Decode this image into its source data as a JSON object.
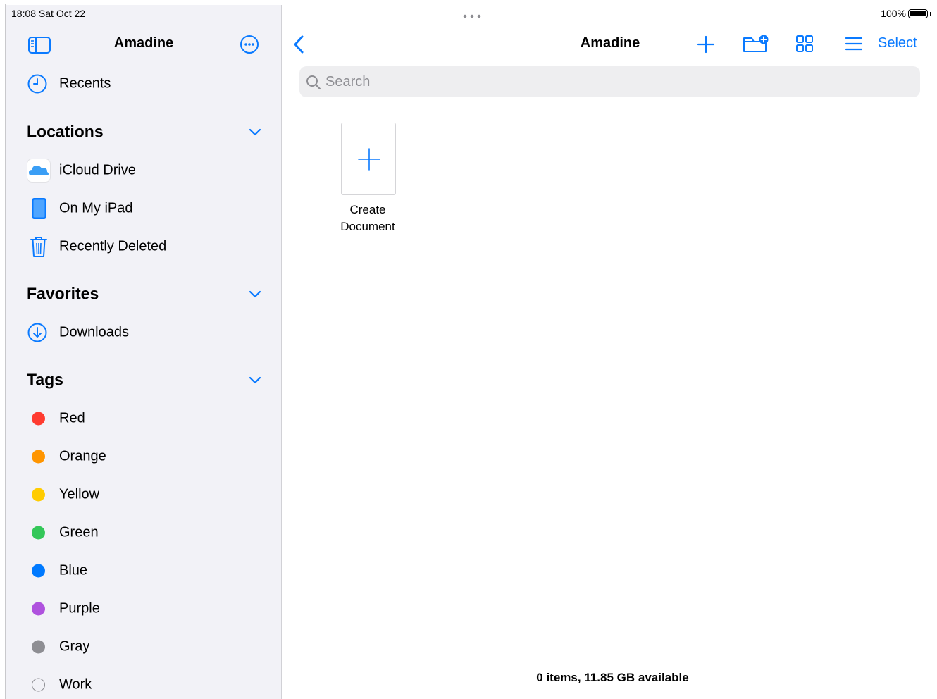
{
  "status_bar": {
    "time_date": "18:08  Sat Oct 22",
    "battery": "100%"
  },
  "sidebar": {
    "title": "Amadine",
    "recents_label": "Recents",
    "sections": {
      "locations": "Locations",
      "favorites": "Favorites",
      "tags": "Tags"
    },
    "locations": [
      {
        "label": "iCloud Drive",
        "icon": "icloud-icon"
      },
      {
        "label": "On My iPad",
        "icon": "ipad-icon"
      },
      {
        "label": "Recently Deleted",
        "icon": "trash-icon"
      }
    ],
    "favorites": [
      {
        "label": "Downloads",
        "icon": "download-icon"
      }
    ],
    "tags": [
      {
        "label": "Red",
        "color": "#ff3b30"
      },
      {
        "label": "Orange",
        "color": "#ff9500"
      },
      {
        "label": "Yellow",
        "color": "#ffcc00"
      },
      {
        "label": "Green",
        "color": "#34c759"
      },
      {
        "label": "Blue",
        "color": "#007aff"
      },
      {
        "label": "Purple",
        "color": "#af52de"
      },
      {
        "label": "Gray",
        "color": "#8e8e93"
      },
      {
        "label": "Work",
        "color": ""
      }
    ]
  },
  "main": {
    "title": "Amadine",
    "select_label": "Select",
    "search_placeholder": "Search",
    "create_label_line1": "Create",
    "create_label_line2": "Document",
    "footer": "0 items, 11.85 GB available"
  },
  "colors": {
    "accent": "#0a7aff",
    "sidebar_bg": "#f2f2f7"
  }
}
